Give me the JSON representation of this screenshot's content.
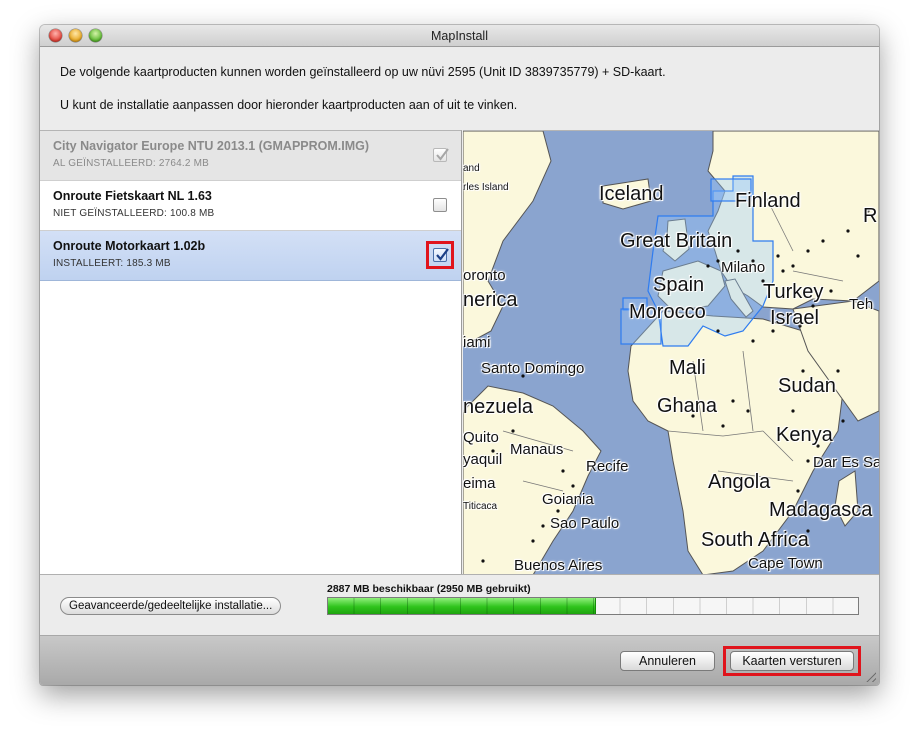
{
  "window": {
    "title": "MapInstall"
  },
  "intro": {
    "line1": "De volgende kaartproducten kunnen worden geïnstalleerd op uw nüvi 2595 (Unit ID 3839735779) + SD-kaart.",
    "line2": "U kunt de installatie aanpassen door hieronder kaartproducten aan of uit te vinken."
  },
  "products": [
    {
      "name": "City Navigator Europe NTU 2013.1 (GMAPPROM.IMG)",
      "status": "AL GEÏNSTALLEERD: 2764.2 MB",
      "checked": true,
      "disabled": true
    },
    {
      "name": "Onroute Fietskaart NL 1.63",
      "status": "NIET GEÏNSTALLEERD: 100.8 MB",
      "checked": false,
      "disabled": false
    },
    {
      "name": "Onroute Motorkaart 1.02b",
      "status": "INSTALLEERT: 185.3 MB",
      "checked": true,
      "disabled": false,
      "selected": true
    }
  ],
  "map": {
    "labels_large": [
      "Iceland",
      "Finland",
      "Great Britain",
      "Spain",
      "Turkey",
      "Morocco",
      "Israel",
      "Mali",
      "Sudan",
      "Ghana",
      "Kenya",
      "Angola",
      "Madagasca",
      "South Africa",
      "R",
      "nerica",
      "nezuela"
    ],
    "labels_medium": [
      "Milano",
      "oronto",
      "Santo Domingo",
      "Manaus",
      "Recife",
      "Goiania",
      "Sao Paulo",
      "Buenos Aires",
      "Cape Town",
      "Dar Es Sa",
      "iami",
      "Quito",
      "yaquil",
      "eima",
      "Teh"
    ],
    "labels_small": [
      "and",
      "rles Island",
      "Titicaca"
    ]
  },
  "storage": {
    "available_text": "2887 MB beschikbaar (2950 MB gebruikt)",
    "used_percent": 50.5
  },
  "buttons": {
    "advanced": "Geavanceerde/gedeeltelijke installatie...",
    "cancel": "Annuleren",
    "send": "Kaarten versturen"
  },
  "colors": {
    "highlight": "#e0141c",
    "progress": "#2fc41c",
    "selection": "#c8d8f3",
    "ocean": "#8aa4cf",
    "land": "#fbf8dc"
  }
}
